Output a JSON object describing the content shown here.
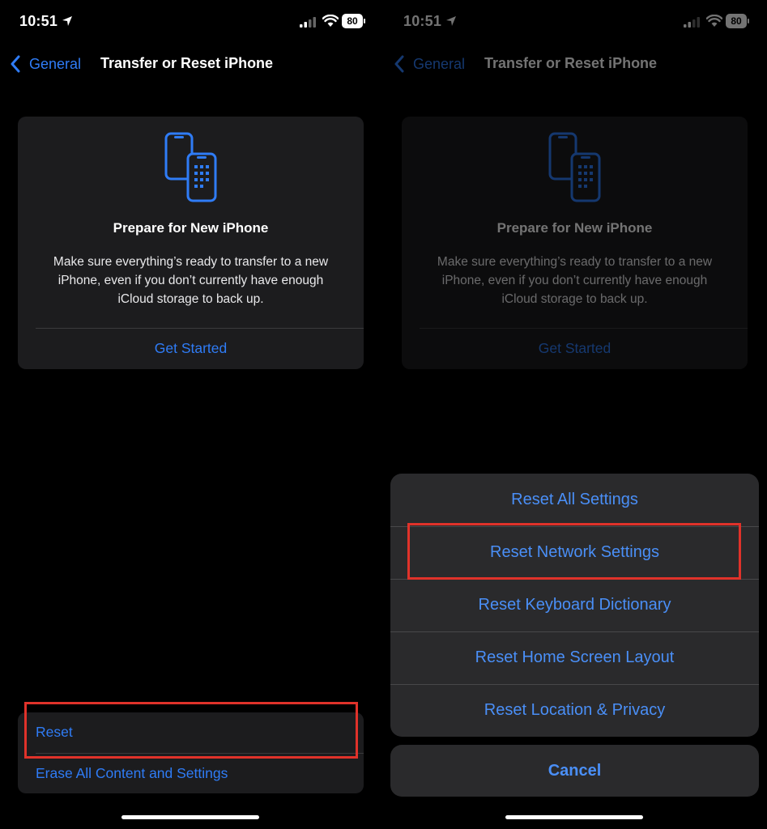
{
  "status": {
    "time": "10:51",
    "battery": "80"
  },
  "nav": {
    "back_label": "General",
    "title": "Transfer or Reset iPhone"
  },
  "card": {
    "title": "Prepare for New iPhone",
    "description": "Make sure everything’s ready to transfer to a new iPhone, even if you don’t currently have enough iCloud storage to back up.",
    "button": "Get Started"
  },
  "reset_group": {
    "reset_label": "Reset",
    "erase_label": "Erase All Content and Settings"
  },
  "action_sheet": {
    "options": [
      "Reset All Settings",
      "Reset Network Settings",
      "Reset Keyboard Dictionary",
      "Reset Home Screen Layout",
      "Reset Location & Privacy"
    ],
    "cancel_label": "Cancel"
  },
  "colors": {
    "accent": "#2f7cf6",
    "highlight": "#e0322a",
    "card_bg": "#1c1c1e"
  }
}
